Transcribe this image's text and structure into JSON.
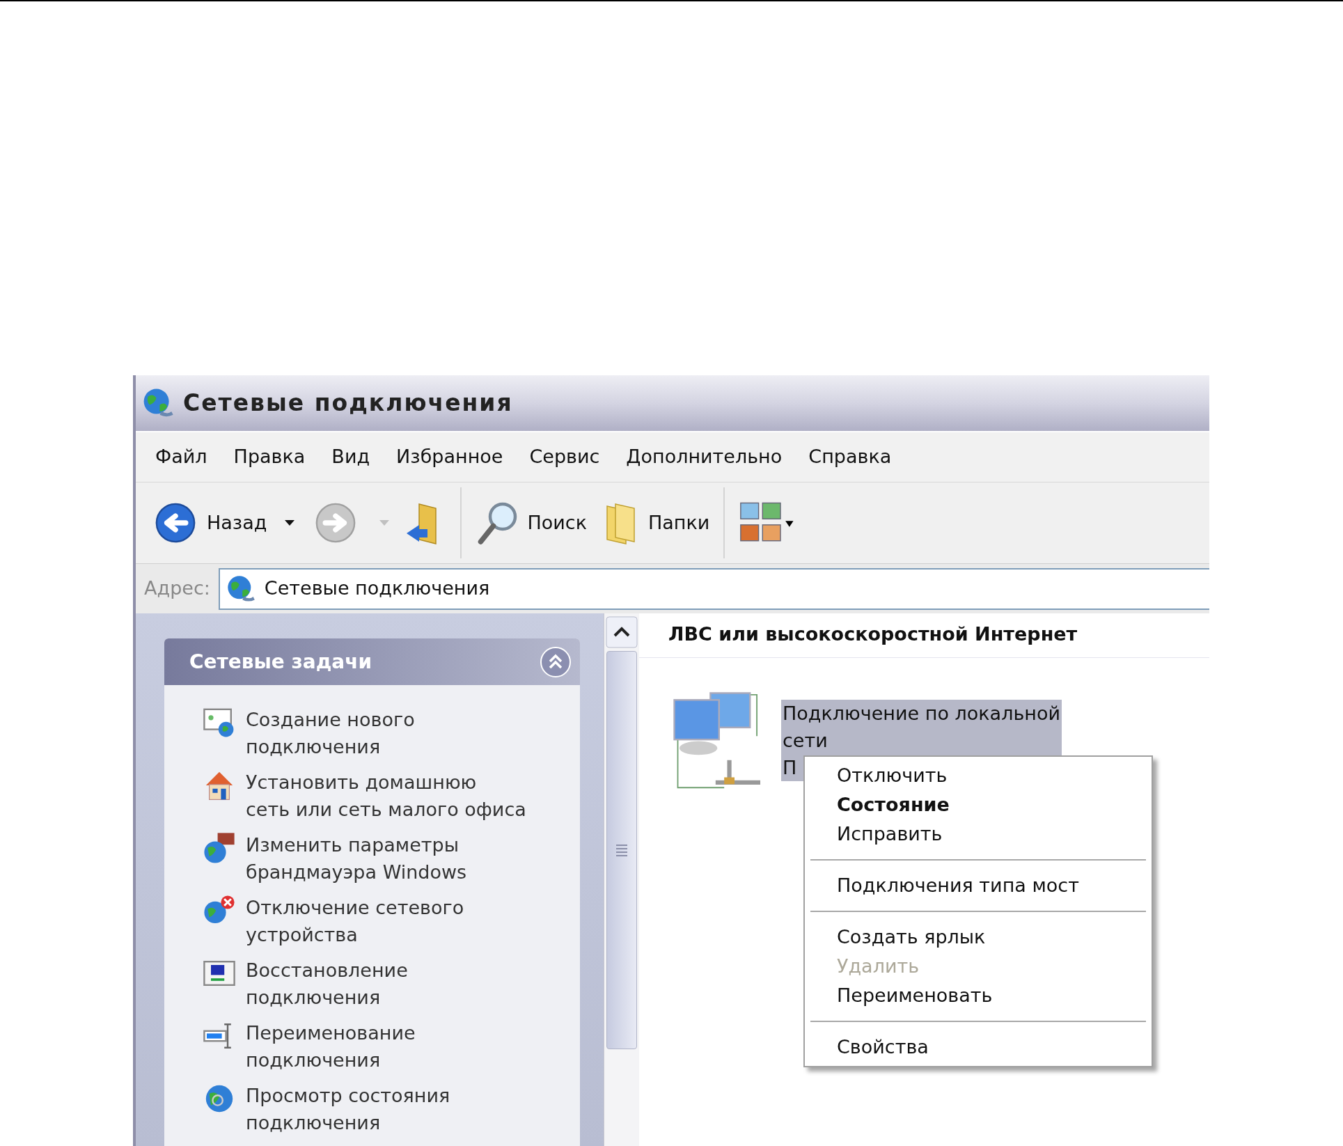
{
  "window": {
    "title": "Сетевые подключения"
  },
  "menu": [
    "Файл",
    "Правка",
    "Вид",
    "Избранное",
    "Сервис",
    "Дополнительно",
    "Справка"
  ],
  "toolbar": [
    {
      "kind": "back",
      "label": "Назад",
      "disabled": false
    },
    {
      "kind": "forward",
      "disabled": true
    },
    {
      "kind": "up"
    },
    {
      "kind": "search",
      "label": "Поиск"
    },
    {
      "kind": "folders",
      "label": "Папки"
    },
    {
      "kind": "views"
    }
  ],
  "address": {
    "label": "Адрес:",
    "value": "Сетевые подключения"
  },
  "tasks": {
    "title": "Сетевые задачи",
    "expanded": true,
    "items": [
      {
        "kind": "new",
        "lines": [
          "Создание нового",
          "подключения"
        ]
      },
      {
        "kind": "home",
        "lines": [
          "Установить домашнюю",
          "сеть или сеть малого офиса"
        ]
      },
      {
        "kind": "firewall",
        "lines": [
          "Изменить параметры",
          "брандмауэра Windows"
        ]
      },
      {
        "kind": "disable",
        "lines": [
          "Отключение сетевого",
          "устройства"
        ]
      },
      {
        "kind": "repair",
        "lines": [
          "Восстановление",
          "подключения"
        ]
      },
      {
        "kind": "rename",
        "lines": [
          "Переименование",
          "подключения"
        ]
      },
      {
        "kind": "status",
        "lines": [
          "Просмотр состояния",
          "подключения"
        ]
      }
    ]
  },
  "content": {
    "group": "ЛВС или высокоскоростной Интернет",
    "connection": {
      "lines": [
        "Подключение по локальной",
        "сети",
        "П"
      ],
      "selected": true
    }
  },
  "context_menu": [
    {
      "kind": "item",
      "label": "Отключить",
      "default": false,
      "disabled": false
    },
    {
      "kind": "item",
      "label": "Состояние",
      "default": true,
      "disabled": false
    },
    {
      "kind": "item",
      "label": "Исправить",
      "default": false,
      "disabled": false
    },
    {
      "kind": "separator"
    },
    {
      "kind": "item",
      "label": "Подключения типа мост",
      "default": false,
      "disabled": false
    },
    {
      "kind": "separator"
    },
    {
      "kind": "item",
      "label": "Создать ярлык",
      "default": false,
      "disabled": false
    },
    {
      "kind": "item",
      "label": "Удалить",
      "default": false,
      "disabled": true
    },
    {
      "kind": "item",
      "label": "Переименовать",
      "default": false,
      "disabled": false
    },
    {
      "kind": "separator"
    },
    {
      "kind": "item",
      "label": "Свойства",
      "default": false,
      "disabled": false
    }
  ]
}
